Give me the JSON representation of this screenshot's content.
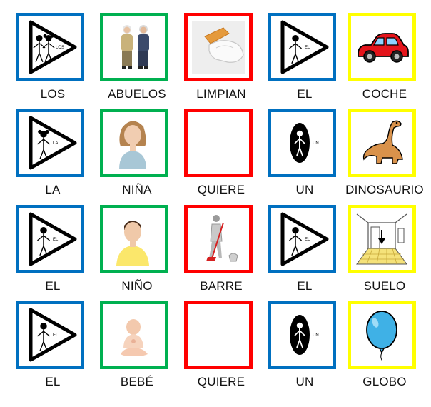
{
  "colors": {
    "article": "#0070c0",
    "noun": "#00b050",
    "verb": "#ff0000",
    "object": "#ffff00"
  },
  "rows": [
    [
      {
        "word": "LOS",
        "category": "article",
        "icon": "article-plural-pictogram-icon",
        "tag": "LOS"
      },
      {
        "word": "ABUELOS",
        "category": "noun",
        "icon": "grandparents-photo-icon"
      },
      {
        "word": "LIMPIAN",
        "category": "verb",
        "icon": "cleaning-hand-photo-icon"
      },
      {
        "word": "EL",
        "category": "article",
        "icon": "article-masculine-pictogram-icon",
        "tag": "EL"
      },
      {
        "word": "COCHE",
        "category": "object",
        "icon": "car-icon"
      }
    ],
    [
      {
        "word": "LA",
        "category": "article",
        "icon": "article-feminine-pictogram-icon",
        "tag": "LA"
      },
      {
        "word": "NIÑA",
        "category": "noun",
        "icon": "girl-photo-icon"
      },
      {
        "word": "QUIERE",
        "category": "verb",
        "icon": "reaching-hand-icon"
      },
      {
        "word": "UN",
        "category": "article",
        "icon": "article-indefinite-pictogram-icon",
        "tag": "UN"
      },
      {
        "word": "DINOSAURIO",
        "category": "object",
        "icon": "dinosaur-icon"
      }
    ],
    [
      {
        "word": "EL",
        "category": "article",
        "icon": "article-masculine-pictogram-icon",
        "tag": "EL"
      },
      {
        "word": "NIÑO",
        "category": "noun",
        "icon": "boy-photo-icon"
      },
      {
        "word": "BARRE",
        "category": "verb",
        "icon": "sweeping-figure-icon"
      },
      {
        "word": "EL",
        "category": "article",
        "icon": "article-masculine-pictogram-icon",
        "tag": "EL"
      },
      {
        "word": "SUELO",
        "category": "object",
        "icon": "floor-room-icon"
      }
    ],
    [
      {
        "word": "EL",
        "category": "article",
        "icon": "article-masculine-pictogram-icon",
        "tag": "EL"
      },
      {
        "word": "BEBÉ",
        "category": "noun",
        "icon": "baby-photo-icon"
      },
      {
        "word": "QUIERE",
        "category": "verb",
        "icon": "reaching-hand-icon"
      },
      {
        "word": "UN",
        "category": "article",
        "icon": "article-indefinite-pictogram-icon",
        "tag": "UN"
      },
      {
        "word": "GLOBO",
        "category": "object",
        "icon": "balloon-icon"
      }
    ]
  ]
}
